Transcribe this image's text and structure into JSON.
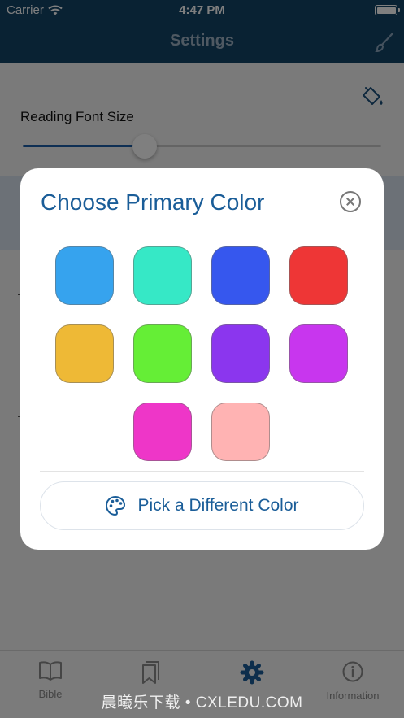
{
  "status_bar": {
    "carrier": "Carrier",
    "time": "4:47 PM"
  },
  "nav": {
    "title": "Settings"
  },
  "settings": {
    "font_size_label": "Reading Font Size",
    "font_size_fraction": 0.34
  },
  "tabs": [
    {
      "label": "Bible",
      "icon": "book-icon",
      "active": false
    },
    {
      "label": "",
      "icon": "bookmarks-icon",
      "active": false
    },
    {
      "label": "",
      "icon": "gear-icon",
      "active": true
    },
    {
      "label": "Information",
      "icon": "info-icon",
      "active": false
    }
  ],
  "modal": {
    "title": "Choose Primary Color",
    "colors": [
      "#36a3ee",
      "#36e8c6",
      "#3657ee",
      "#ee3636",
      "#eeb936",
      "#65ee36",
      "#8b36ee",
      "#c836ee",
      "#ee36c8",
      "#ffb3b3"
    ],
    "pick_button_label": "Pick a Different Color"
  },
  "watermark": "晨曦乐下载 • CXLEDU.COM"
}
